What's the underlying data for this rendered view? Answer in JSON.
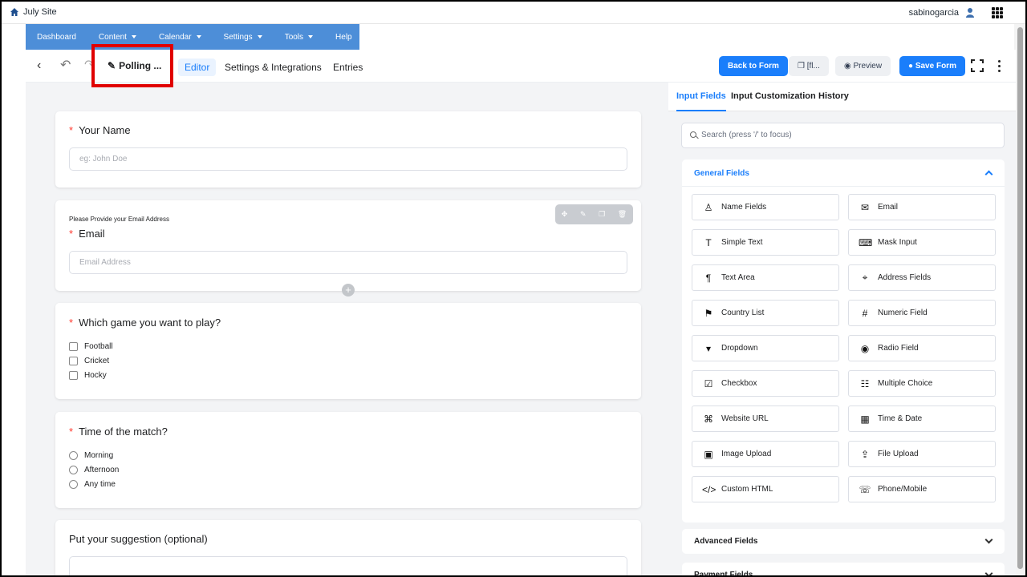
{
  "site": {
    "name": "July Site",
    "user": "sabinogarcia"
  },
  "nav": {
    "items": [
      "Dashboard",
      "Content",
      "Calendar",
      "Settings",
      "Tools",
      "Help"
    ]
  },
  "editor": {
    "form_title": "Polling ...",
    "tabs": [
      "Editor",
      "Settings & Integrations",
      "Entries"
    ],
    "back_label": "Back to Form",
    "shortcode": "[fl...",
    "preview_label": "Preview",
    "save_label": "Save Form"
  },
  "form": {
    "name": {
      "label": "Your Name",
      "placeholder": "eg: John Doe"
    },
    "email": {
      "description": "Please Provide your Email Address",
      "label": "Email",
      "placeholder": "Email Address"
    },
    "game": {
      "label": "Which game you want to play?",
      "options": [
        "Football",
        "Cricket",
        "Hocky"
      ]
    },
    "time": {
      "label": "Time of the match?",
      "options": [
        "Morning",
        "Afternoon",
        "Any time"
      ]
    },
    "suggestion": {
      "label": "Put your suggestion (optional)"
    }
  },
  "sidebar": {
    "tabs": [
      "Input Fields",
      "Input Customization",
      "History"
    ],
    "search_placeholder": "Search (press '/' to focus)",
    "general_title": "General Fields",
    "fields": [
      "Name Fields",
      "Email",
      "Simple Text",
      "Mask Input",
      "Text Area",
      "Address Fields",
      "Country List",
      "Numeric Field",
      "Dropdown",
      "Radio Field",
      "Checkbox",
      "Multiple Choice",
      "Website URL",
      "Time & Date",
      "Image Upload",
      "File Upload",
      "Custom HTML",
      "Phone/Mobile"
    ],
    "advanced_title": "Advanced Fields",
    "payment_title": "Payment Fields"
  },
  "icons": [
    "home-icon",
    "user-icon",
    "apps-grid-icon",
    "back-icon",
    "undo-icon",
    "redo-icon",
    "edit-icon",
    "copy-icon",
    "eye-icon",
    "save-icon",
    "fullscreen-icon",
    "more-icon",
    "search-icon",
    "chevron-up-icon",
    "chevron-down-icon"
  ],
  "colors": {
    "accent": "#1a7efb",
    "nav": "#4d8ed8",
    "required": "#ff3b30",
    "highlight": "#e00000"
  }
}
